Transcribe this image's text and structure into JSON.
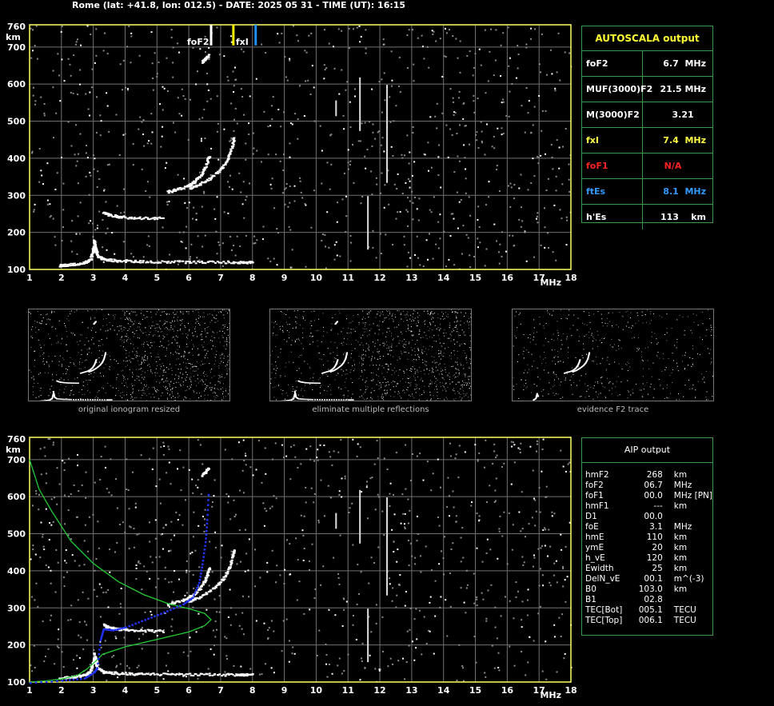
{
  "header": {
    "title": "Rome (lat: +41.8, lon: 012.5) - DATE: 2025 05 31 - TIME (UT): 16:15"
  },
  "colors": {
    "axis_frame": "#ffff66",
    "grid": "#707070",
    "panel_border": "#3c9a4a",
    "trace": "#ffffff",
    "profile_green": "#22cc33",
    "profile_blue": "#2233ff",
    "marker_yellow": "#ffee00",
    "marker_blue": "#1e90ff",
    "title_yellow": "#ffff33",
    "fof1_red": "#ff2222",
    "ftes_blue": "#3399ff",
    "fxi_yellow": "#ffff44"
  },
  "autoscala": {
    "title": "AUTOSCALA output",
    "rows": [
      {
        "label": "foF2",
        "value": "6.7  MHz",
        "color": "#ffffff"
      },
      {
        "label": "MUF(3000)F2",
        "value": "21.5 MHz",
        "color": "#ffffff"
      },
      {
        "label": "M(3000)F2",
        "value": "3.21    ",
        "color": "#ffffff"
      },
      {
        "label": "fxI",
        "value": "7.4  MHz",
        "color": "#ffff44"
      },
      {
        "label": "foF1",
        "value": "N/A        ",
        "color": "#ff2222"
      },
      {
        "label": "ftEs",
        "value": "8.1  MHz",
        "color": "#3399ff"
      },
      {
        "label": "h'Es",
        "value": "113    km",
        "color": "#ffffff"
      }
    ]
  },
  "aip": {
    "title": "AIP output",
    "rows": [
      [
        "hmF2",
        "268",
        "km"
      ],
      [
        "foF2",
        "06.7",
        "MHz"
      ],
      [
        "foF1",
        "00.0",
        "MHz   [PN]"
      ],
      [
        "hmF1",
        "---",
        "km"
      ],
      [
        "D1",
        "00.0",
        ""
      ],
      [
        "foE",
        "3.1",
        "MHz"
      ],
      [
        "hmE",
        "110",
        "km"
      ],
      [
        "ymE",
        "20",
        "km"
      ],
      [
        "h_vE",
        "120",
        "km"
      ],
      [
        "Ewidth",
        "25",
        "km"
      ],
      [
        "DelN_vE",
        "00.1",
        "m^(-3)"
      ],
      [
        "B0",
        "103.0",
        "km"
      ],
      [
        "B1",
        "02.8",
        ""
      ],
      [
        "TEC[Bot]",
        "005.1",
        "TECU"
      ],
      [
        "TEC[Top]",
        "006.1",
        "TECU"
      ]
    ]
  },
  "thumbnails": [
    {
      "caption": "original ionogram resized"
    },
    {
      "caption": "eliminate multiple reflections"
    },
    {
      "caption": "evidence F2 trace"
    }
  ],
  "chart_data": [
    {
      "type": "scatter",
      "x_unit": "MHz",
      "y_unit": "km",
      "xlim": [
        1,
        18
      ],
      "ylim": [
        100,
        760
      ],
      "x_ticks": [
        1,
        2,
        3,
        4,
        5,
        6,
        7,
        8,
        9,
        10,
        11,
        12,
        13,
        14,
        15,
        16,
        17,
        18
      ],
      "y_ticks": [
        100,
        200,
        300,
        400,
        500,
        600,
        700,
        760
      ],
      "grid": true,
      "markers": [
        {
          "label": "foF2",
          "x": 6.7,
          "color": "#ffffff"
        },
        {
          "label": "fxI",
          "x": 7.4,
          "color": "#ffee00"
        },
        {
          "label": "",
          "x": 8.1,
          "color": "#1e90ff"
        }
      ],
      "traces": {
        "E_layer": [
          [
            1.9,
            112
          ],
          [
            2.3,
            115
          ],
          [
            2.7,
            120
          ],
          [
            2.9,
            130
          ],
          [
            3.0,
            165
          ],
          [
            3.1,
            140
          ],
          [
            3.3,
            128
          ],
          [
            3.8,
            125
          ],
          [
            4.5,
            123
          ],
          [
            5.5,
            122
          ],
          [
            6.5,
            122
          ],
          [
            7.5,
            121
          ],
          [
            8.0,
            121
          ]
        ],
        "Es_cusp": [
          [
            3.0,
            180
          ],
          [
            3.05,
            160
          ],
          [
            3.1,
            145
          ]
        ],
        "spread_240": [
          [
            3.3,
            255
          ],
          [
            3.5,
            248
          ],
          [
            3.8,
            244
          ],
          [
            4.2,
            241
          ],
          [
            4.7,
            240
          ],
          [
            5.2,
            239
          ]
        ],
        "F2_O": [
          [
            5.3,
            310
          ],
          [
            5.6,
            318
          ],
          [
            5.9,
            325
          ],
          [
            6.1,
            335
          ],
          [
            6.3,
            350
          ],
          [
            6.45,
            370
          ],
          [
            6.55,
            390
          ],
          [
            6.62,
            410
          ]
        ],
        "F2_X": [
          [
            6.0,
            320
          ],
          [
            6.3,
            330
          ],
          [
            6.6,
            345
          ],
          [
            6.9,
            365
          ],
          [
            7.1,
            385
          ],
          [
            7.25,
            410
          ],
          [
            7.35,
            440
          ],
          [
            7.4,
            460
          ]
        ],
        "F2_multi": [
          [
            6.4,
            660
          ],
          [
            6.5,
            670
          ],
          [
            6.6,
            680
          ]
        ]
      }
    },
    {
      "type": "scatter",
      "x_unit": "MHz",
      "y_unit": "km",
      "xlim": [
        1,
        18
      ],
      "ylim": [
        100,
        760
      ],
      "x_ticks": [
        1,
        2,
        3,
        4,
        5,
        6,
        7,
        8,
        9,
        10,
        11,
        12,
        13,
        14,
        15,
        16,
        17,
        18
      ],
      "y_ticks": [
        100,
        200,
        300,
        400,
        500,
        600,
        700,
        760
      ],
      "grid": true,
      "profile_green": [
        [
          1.0,
          700
        ],
        [
          1.3,
          620
        ],
        [
          1.7,
          560
        ],
        [
          2.3,
          480
        ],
        [
          3.0,
          420
        ],
        [
          3.8,
          370
        ],
        [
          4.6,
          335
        ],
        [
          5.4,
          310
        ],
        [
          6.0,
          298
        ],
        [
          6.5,
          285
        ],
        [
          6.7,
          268
        ],
        [
          6.5,
          252
        ],
        [
          6.0,
          235
        ],
        [
          5.0,
          215
        ],
        [
          4.0,
          195
        ],
        [
          3.3,
          175
        ],
        [
          3.0,
          150
        ],
        [
          2.8,
          135
        ],
        [
          2.5,
          118
        ],
        [
          2.0,
          108
        ],
        [
          1.5,
          103
        ],
        [
          1.0,
          100
        ]
      ],
      "profile_blue": [
        [
          1.0,
          100
        ],
        [
          2.0,
          106
        ],
        [
          2.7,
          112
        ],
        [
          3.0,
          128
        ],
        [
          3.1,
          140
        ],
        [
          3.2,
          215
        ],
        [
          3.3,
          245
        ],
        [
          3.6,
          242
        ],
        [
          4.0,
          250
        ],
        [
          4.6,
          270
        ],
        [
          5.2,
          290
        ],
        [
          5.8,
          312
        ],
        [
          6.1,
          330
        ],
        [
          6.3,
          370
        ],
        [
          6.4,
          420
        ],
        [
          6.5,
          480
        ],
        [
          6.55,
          540
        ],
        [
          6.6,
          620
        ]
      ]
    }
  ]
}
